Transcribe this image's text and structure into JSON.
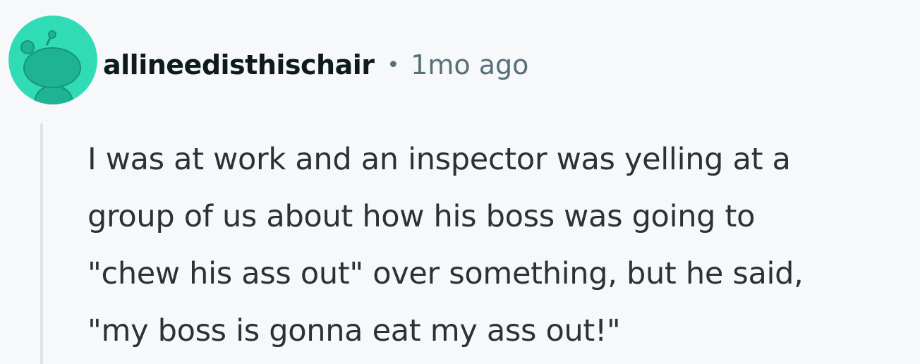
{
  "comment": {
    "username": "allineedisthischair",
    "separator": "•",
    "timestamp": "1mo ago",
    "avatar": {
      "icon": "snoo-avatar-icon",
      "background_color": "#2fdcb6",
      "figure_color": "#1fb395"
    },
    "body_lines": [
      "I was at work and an inspector was yelling at a",
      "group of us about how his boss was going to",
      "\"chew his ass out\" over something, but he said,",
      "\"my boss is gonna eat my ass out!\""
    ],
    "thread_line_color": "#dfe4ea"
  }
}
